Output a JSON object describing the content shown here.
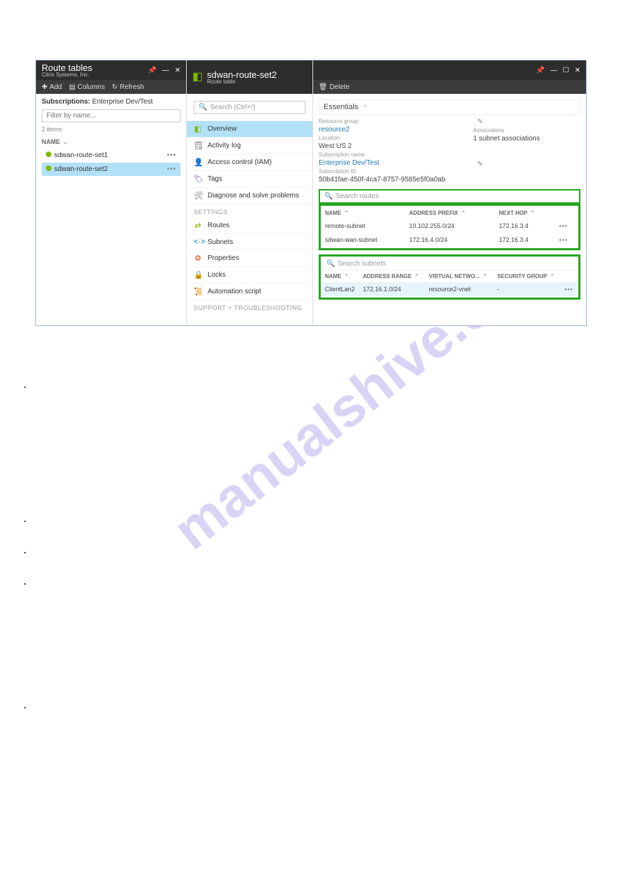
{
  "watermark": "manualshive.com",
  "panel1": {
    "title": "Route tables",
    "subtitle": "Citrix Systems, Inc.",
    "toolbar": {
      "add": "Add",
      "columns": "Columns",
      "refresh": "Refresh"
    },
    "subscriptions_label": "Subscriptions:",
    "subscriptions_value": "Enterprise Dev/Test",
    "filter_placeholder": "Filter by name...",
    "items_count": "2 items",
    "col_name": "NAME",
    "rows": [
      {
        "name": "sdwan-route-set1"
      },
      {
        "name": "sdwan-route-set2"
      }
    ]
  },
  "panel2": {
    "search_placeholder": "Search (Ctrl+/)",
    "items": [
      {
        "label": "Overview"
      },
      {
        "label": "Activity log"
      },
      {
        "label": "Access control (IAM)"
      },
      {
        "label": "Tags"
      },
      {
        "label": "Diagnose and solve problems"
      }
    ],
    "section_settings": "SETTINGS",
    "settings": [
      {
        "label": "Routes"
      },
      {
        "label": "Subnets"
      },
      {
        "label": "Properties"
      },
      {
        "label": "Locks"
      },
      {
        "label": "Automation script"
      }
    ],
    "section_support": "SUPPORT + TROUBLESHOOTING"
  },
  "panel3": {
    "title": "sdwan-route-set2",
    "subtitle": "Route table",
    "delete": "Delete",
    "essentials_label": "Essentials",
    "resource_group_lbl": "Resource group",
    "resource_group_val": "resource2",
    "location_lbl": "Location",
    "location_val": "West US 2",
    "subscription_name_lbl": "Subscription name",
    "subscription_name_val": "Enterprise Dev/Test",
    "subscription_id_lbl": "Subscription ID",
    "subscription_id_val": "50b41fae-450f-4ca7-8757-9585e5f0a0ab",
    "associations_lbl": "Associations",
    "associations_val": "1 subnet associations",
    "search_routes": "Search routes",
    "routes_cols": {
      "name": "NAME",
      "prefix": "ADDRESS PREFIX",
      "nexthop": "NEXT HOP"
    },
    "routes": [
      {
        "name": "remote-subnet",
        "prefix": "10.102.255.0/24",
        "nexthop": "172.16.3.4"
      },
      {
        "name": "sdwan-wan-subnet",
        "prefix": "172.16.4.0/24",
        "nexthop": "172.16.3.4"
      }
    ],
    "search_subnets": "Search subnets",
    "subnets_cols": {
      "name": "NAME",
      "range": "ADDRESS RANGE",
      "vnet": "VIRTUAL NETWO...",
      "sg": "SECURITY GROUP"
    },
    "subnets": [
      {
        "name": "ClientLan2",
        "range": "172.16.1.0/24",
        "vnet": "resource2-vnet",
        "sg": "-"
      }
    ]
  }
}
